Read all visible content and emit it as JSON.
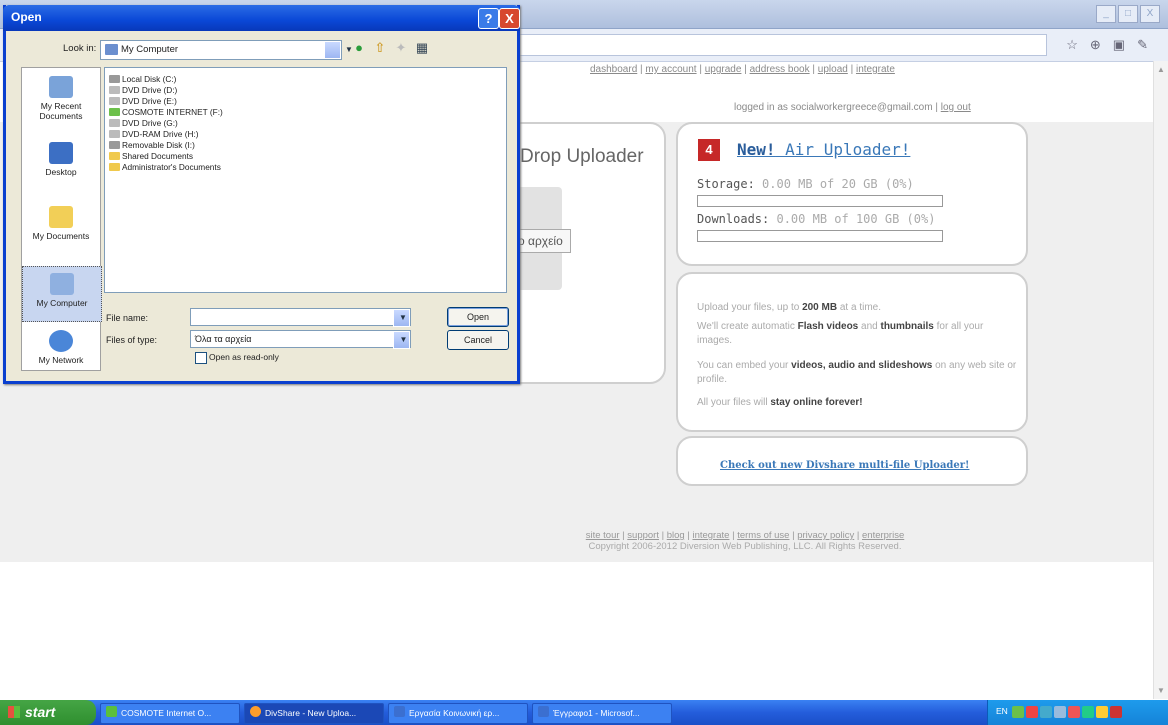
{
  "browser": {
    "window_buttons": [
      "_",
      "□",
      "X"
    ],
    "toolbar_icons": [
      "star-icon",
      "feed-icon",
      "page-icon",
      "tools-icon"
    ]
  },
  "page": {
    "top_links": [
      "dashboard",
      "my account",
      "upgrade",
      "address book",
      "upload",
      "integrate"
    ],
    "logged_in_prefix": "logged in as socialworkergreece@gmail.com |",
    "logout_label": "log out",
    "uploader_title": "Drop Uploader",
    "drop_button_text": "ο αρχείο",
    "air_icon_text": "4",
    "air_new": "New!",
    "air_title": " Air Uploader!",
    "storage_label": "Storage:",
    "storage_value": "0.00 MB of 20 GB (0%)",
    "storage_fraction": 0,
    "downloads_label": "Downloads:",
    "downloads_value": "0.00 MB of 100 GB (0%)",
    "downloads_fraction": 0,
    "info": {
      "line1_pre": "Upload your files, up to ",
      "line1_bold": "200 MB",
      "line1_post": " at a time.",
      "line2_pre": "We'll create automatic ",
      "line2_bold1": "Flash videos",
      "line2_mid": " and ",
      "line2_bold2": "thumbnails",
      "line2_post": " for all your images.",
      "line3_pre": "You can embed your ",
      "line3_bold": "videos, audio and slideshows",
      "line3_post": " on any web site or profile.",
      "line4_pre": "All your files will ",
      "line4_bold": "stay online forever!"
    },
    "multi_link": "Check out new Divshare multi-file Uploader!",
    "footer_links": [
      "site tour",
      "support",
      "blog",
      "integrate",
      "terms of use",
      "privacy policy",
      "enterprise"
    ],
    "copyright": "Copyright 2006-2012 Diversion Web Publishing, LLC. All Rights Reserved."
  },
  "dialog": {
    "title": "Open",
    "help_btn": "?",
    "close_btn": "X",
    "lookin_label": "Look in:",
    "lookin_value": "My Computer",
    "places": [
      "My Recent Documents",
      "Desktop",
      "My Documents",
      "My Computer",
      "My Network"
    ],
    "files": [
      "Local Disk (C:)",
      "DVD Drive (D:)",
      "DVD Drive (E:)",
      "COSMOTE INTERNET (F:)",
      "DVD Drive (G:)",
      "DVD-RAM Drive (H:)",
      "Removable Disk (I:)",
      "Shared Documents",
      "Administrator's Documents"
    ],
    "file_name_label": "File name:",
    "file_name_value": "",
    "file_type_label": "Files of type:",
    "file_type_value": "Όλα τα αρχεία",
    "readonly_label": "Open as read-only",
    "open_btn": "Open",
    "cancel_btn": "Cancel"
  },
  "taskbar": {
    "start": "start",
    "tasks": [
      "COSMOTE Internet O...",
      "DivShare - New Uploa...",
      "Εργασία Κοινωνική ερ...",
      "Έγγραφο1 - Microsof..."
    ],
    "lang": "EN"
  }
}
